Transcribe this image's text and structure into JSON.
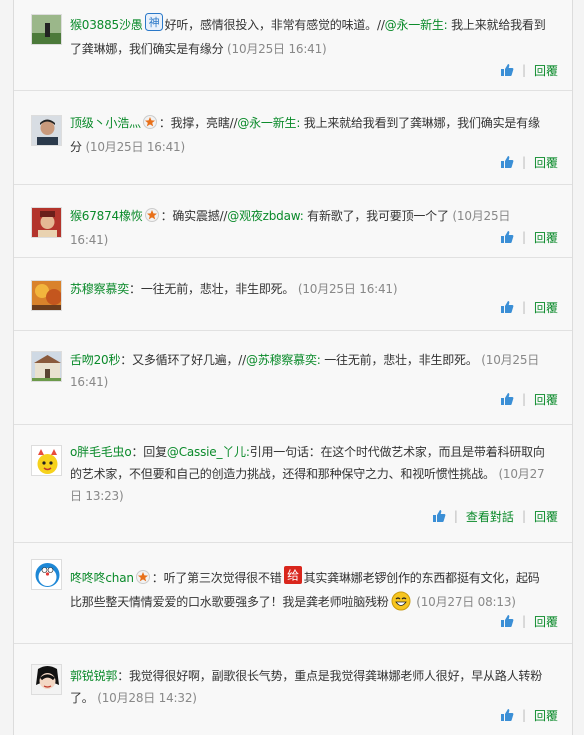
{
  "comments": [
    {
      "user": "猴03885沙愚",
      "badge": "神",
      "text_before": "好听，感情很投入，非常有感觉的味道。//",
      "mention": "@永一新生:",
      "text_after": " 我上来就给我看到了龚琳娜，我们确实是有缘分",
      "time": "(10月25日 16:41)",
      "reply": "回覆"
    },
    {
      "user": "顶级丶小浩灬",
      "text_before": "：我撑，亮瞎//",
      "mention": "@永一新生:",
      "text_after": " 我上来就给我看到了龚琳娜，我们确实是有缘分",
      "time": "(10月25日 16:41)",
      "reply": "回覆"
    },
    {
      "user": "猴67874橡恢",
      "text_before": "：确实震撼//",
      "mention": "@观夜zbdaw:",
      "text_after": " 有新歌了，我可要顶一个了",
      "time": "(10月25日 16:41)",
      "reply": "回覆"
    },
    {
      "user": "苏穆察慕奕",
      "text_before": "：一往无前，悲壮，非生即死。",
      "time": "(10月25日 16:41)",
      "reply": "回覆"
    },
    {
      "user": "舌吻20秒",
      "text_before": "：又多循环了好几遍，//",
      "mention": "@苏穆察慕奕:",
      "text_after": " 一往无前，悲壮，非生即死。",
      "time": "(10月25日 16:41)",
      "reply": "回覆"
    },
    {
      "user": "o胖毛毛虫o",
      "text_before": "：回复",
      "mention": "@Cassie_丫儿:",
      "text_after": "引用一句话：在这个时代做艺术家，而且是带着科研取向的艺术家，不但要和自己的创造力挑战，还得和那种保守之力、和视听惯性挑战。",
      "time": "(10月27日 13:23)",
      "view_chat": "查看對話",
      "reply": "回覆"
    },
    {
      "user": "咚咚咚chan",
      "text_before": "：听了第三次觉得很不错",
      "badge2": "给",
      "text_after": "其实龚琳娜老锣创作的东西都挺有文化，起码比那些整天情情爱爱的口水歌要强多了！我是龚老师啦脑残粉",
      "time": "(10月27日 08:13)",
      "reply": "回覆"
    },
    {
      "user": "郭锐锐郭",
      "text_before": "：我觉得很好啊，副歌很长气势，重点是我觉得龚琳娜老师人很好，早从路人转粉了。",
      "time": "(10月28日 14:32)",
      "reply": "回覆"
    }
  ],
  "colors": {
    "link": "#0a8a2a",
    "time": "#888888",
    "thumb": "#3b8fd6",
    "vip": "#e8701a"
  }
}
